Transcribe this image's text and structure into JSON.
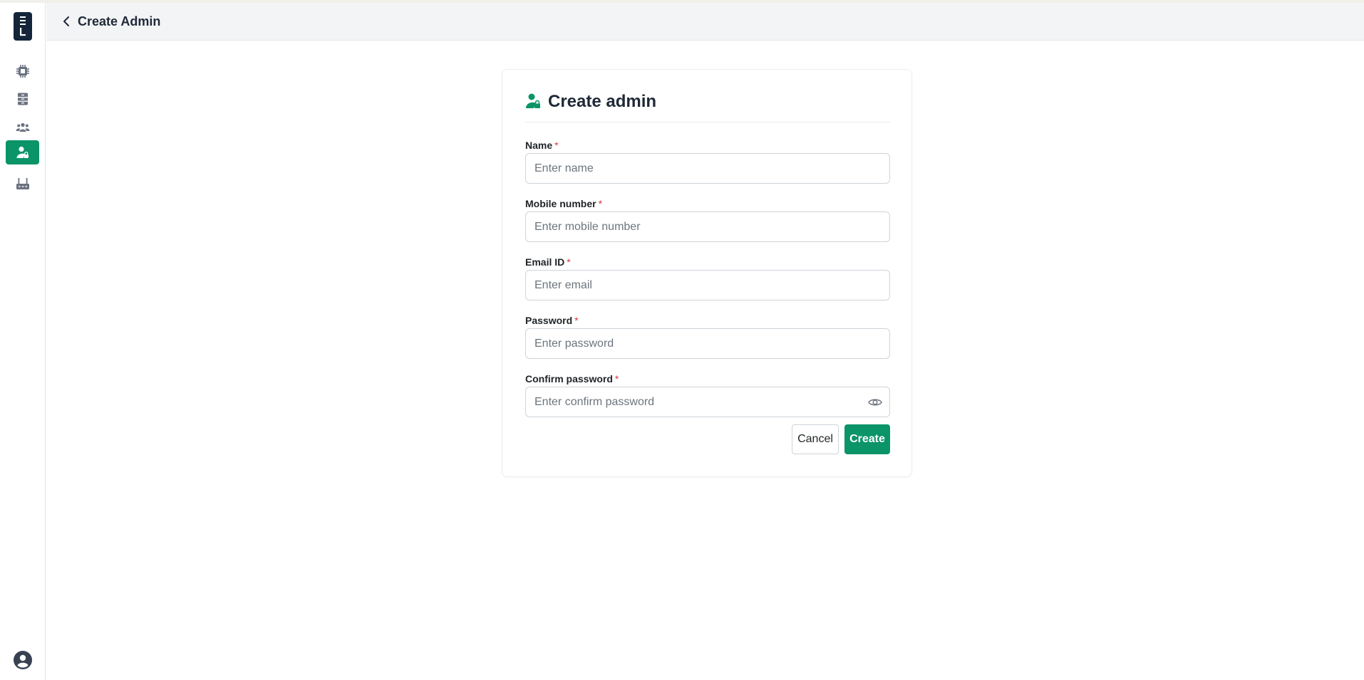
{
  "header": {
    "title": "Create Admin"
  },
  "sidebar": {
    "items": [
      {
        "name": "chip-icon",
        "active": false
      },
      {
        "name": "cabinet-icon",
        "active": false
      },
      {
        "name": "users-group-icon",
        "active": false
      },
      {
        "name": "admin-user-icon",
        "active": true
      },
      {
        "name": "router-icon",
        "active": false
      }
    ],
    "profile_icon": "user-circle-icon"
  },
  "card": {
    "title": "Create admin",
    "icon": "admin-user-icon"
  },
  "form": {
    "name": {
      "label": "Name",
      "required_mark": "*",
      "placeholder": "Enter name",
      "value": ""
    },
    "mobile": {
      "label": "Mobile number",
      "required_mark": "*",
      "placeholder": "Enter mobile number",
      "value": ""
    },
    "email": {
      "label": "Email ID",
      "required_mark": "*",
      "placeholder": "Enter email",
      "value": ""
    },
    "password": {
      "label": "Password",
      "required_mark": "*",
      "placeholder": "Enter password",
      "value": ""
    },
    "confirm_password": {
      "label": "Confirm password",
      "required_mark": "*",
      "placeholder": "Enter confirm password",
      "value": ""
    }
  },
  "actions": {
    "cancel_label": "Cancel",
    "create_label": "Create"
  },
  "colors": {
    "accent": "#0b9468",
    "logo": "#14243a",
    "required": "#dc3545"
  }
}
